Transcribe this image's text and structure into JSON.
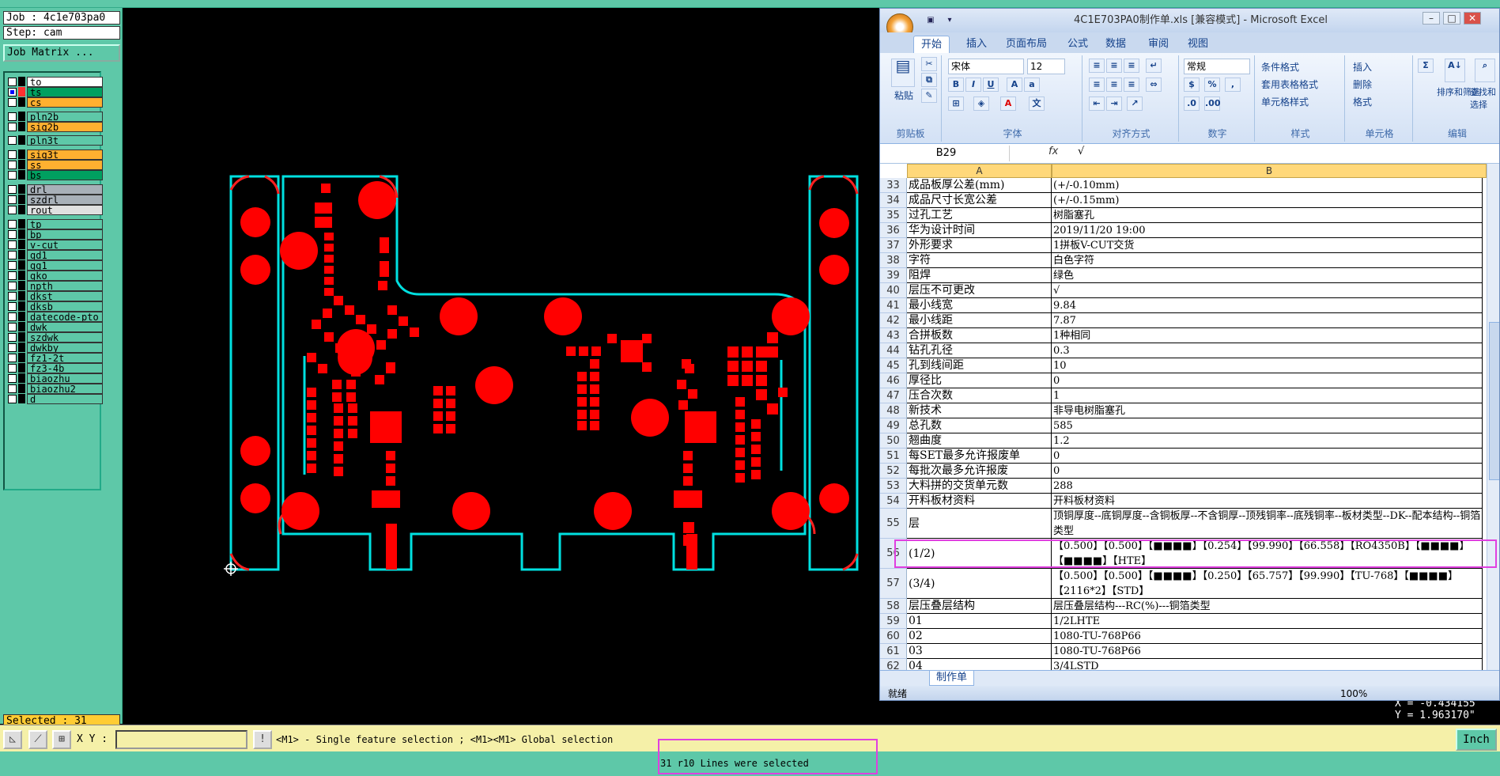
{
  "cam": {
    "job_label": "Job : 4c1e703pa0",
    "step_label": "Step: cam",
    "matrix_button": "Job Matrix ...",
    "selected": "Selected : 31",
    "xy_label": "X Y :",
    "xy_value": "",
    "prompt": "<M1> - Single feature selection ; <M1><M1> Global selection",
    "unit_button": "Inch",
    "status_message": "31 r10 Lines were selected",
    "coord_x": "X = -0.434155",
    "coord_y": "Y = 1.963170\"",
    "layers": [
      {
        "name": "to",
        "bg": "#ffffff",
        "color": "#000000"
      },
      {
        "name": "ts",
        "bg": "#00a060",
        "color": "#ff3030",
        "active": true
      },
      {
        "name": "cs",
        "bg": "#ffb030",
        "color": "#000000"
      },
      {
        "name": "pln2b",
        "bg": "#5ec8a8",
        "color": "#000000"
      },
      {
        "name": "sig2b",
        "bg": "#ffb030",
        "color": "#000000"
      },
      {
        "name": "pln3t",
        "bg": "#5ec8a8",
        "color": "#000000"
      },
      {
        "name": "sig3t",
        "bg": "#ffb030",
        "color": "#000000"
      },
      {
        "name": "ss",
        "bg": "#ffb030",
        "color": "#000000"
      },
      {
        "name": "bs",
        "bg": "#00a060",
        "color": "#000000"
      },
      {
        "name": "drl",
        "bg": "#a8b0b8",
        "color": "#000000"
      },
      {
        "name": "szdrl",
        "bg": "#a8b0b8",
        "color": "#000000"
      },
      {
        "name": "rout",
        "bg": "#e0e0e0",
        "color": "#000000"
      },
      {
        "name": "tp",
        "bg": "#5ec8a8",
        "color": "#000000"
      },
      {
        "name": "bp",
        "bg": "#5ec8a8",
        "color": "#000000"
      },
      {
        "name": "v-cut",
        "bg": "#5ec8a8",
        "color": "#000000"
      },
      {
        "name": "gd1",
        "bg": "#5ec8a8",
        "color": "#000000"
      },
      {
        "name": "gg1",
        "bg": "#5ec8a8",
        "color": "#000000"
      },
      {
        "name": "gko",
        "bg": "#5ec8a8",
        "color": "#000000"
      },
      {
        "name": "npth",
        "bg": "#5ec8a8",
        "color": "#000000"
      },
      {
        "name": "dkst",
        "bg": "#5ec8a8",
        "color": "#000000"
      },
      {
        "name": "dksb",
        "bg": "#5ec8a8",
        "color": "#000000"
      },
      {
        "name": "datecode-pto",
        "bg": "#5ec8a8",
        "color": "#000000"
      },
      {
        "name": "dwk",
        "bg": "#5ec8a8",
        "color": "#000000"
      },
      {
        "name": "szdwk",
        "bg": "#5ec8a8",
        "color": "#000000"
      },
      {
        "name": "dwkby",
        "bg": "#5ec8a8",
        "color": "#000000"
      },
      {
        "name": "fz1-2t",
        "bg": "#5ec8a8",
        "color": "#000000"
      },
      {
        "name": "fz3-4b",
        "bg": "#5ec8a8",
        "color": "#000000"
      },
      {
        "name": "biaozhu",
        "bg": "#5ec8a8",
        "color": "#000000"
      },
      {
        "name": "biaozhu2",
        "bg": "#5ec8a8",
        "color": "#000000"
      },
      {
        "name": "d",
        "bg": "#5ec8a8",
        "color": "#000000"
      }
    ]
  },
  "excel": {
    "title": "4C1E703PA0制作单.xls  [兼容模式] - Microsoft Excel",
    "tabs": [
      "开始",
      "插入",
      "页面布局",
      "公式",
      "数据",
      "审阅",
      "视图"
    ],
    "groups": {
      "clipboard": "剪贴板",
      "font": "字体",
      "align": "对齐方式",
      "number": "数字",
      "style": "样式",
      "cells": "单元格",
      "edit": "编辑"
    },
    "buttons": {
      "paste": "粘贴",
      "cond_format": "条件格式",
      "table_format": "套用表格格式",
      "cell_style": "单元格样式",
      "insert": "插入",
      "delete": "删除",
      "format": "格式",
      "sort": "排序和筛选",
      "find": "查找和选择"
    },
    "font_name": "宋体",
    "font_size": "12",
    "number_format": "常规",
    "name_box": "B29",
    "fx": "fx",
    "formula": "√",
    "col_a": "A",
    "col_b": "B",
    "rows": [
      {
        "num": "33",
        "a": "成品板厚公差(mm)",
        "b": "(+/-0.10mm)"
      },
      {
        "num": "34",
        "a": "成品尺寸长宽公差",
        "b": "(+/-0.15mm)"
      },
      {
        "num": "35",
        "a": "过孔工艺",
        "b": "树脂塞孔"
      },
      {
        "num": "36",
        "a": "华为设计时间",
        "b": "2019/11/20 19:00"
      },
      {
        "num": "37",
        "a": "外形要求",
        "b": "1拼板V-CUT交货"
      },
      {
        "num": "38",
        "a": "字符",
        "b": "白色字符"
      },
      {
        "num": "39",
        "a": "阻焊",
        "b": "绿色"
      },
      {
        "num": "40",
        "a": "层压不可更改",
        "b": "√"
      },
      {
        "num": "41",
        "a": "最小线宽",
        "b": "9.84"
      },
      {
        "num": "42",
        "a": "最小线距",
        "b": "7.87"
      },
      {
        "num": "43",
        "a": "合拼板数",
        "b": "1种相同"
      },
      {
        "num": "44",
        "a": "钻孔孔径",
        "b": "0.3"
      },
      {
        "num": "45",
        "a": "孔到线间距",
        "b": "10"
      },
      {
        "num": "46",
        "a": "厚径比",
        "b": "0"
      },
      {
        "num": "47",
        "a": "压合次数",
        "b": "1"
      },
      {
        "num": "48",
        "a": "新技术",
        "b": "非导电树脂塞孔"
      },
      {
        "num": "49",
        "a": "总孔数",
        "b": "585"
      },
      {
        "num": "50",
        "a": "翘曲度",
        "b": "1.2"
      },
      {
        "num": "51",
        "a": "每SET最多允许报废单",
        "b": "0"
      },
      {
        "num": "52",
        "a": "每批次最多允许报废",
        "b": "0"
      },
      {
        "num": "53",
        "a": "大料拼的交货单元数",
        "b": "288"
      },
      {
        "num": "54",
        "a": "开料板材资料",
        "b": "开料板材资料"
      },
      {
        "num": "55",
        "a": "层",
        "b": "顶铜厚度--底铜厚度--含铜板厚--不含铜厚--顶残铜率--底残铜率--板材类型--DK--配本结构--铜箔类型"
      },
      {
        "num": "56",
        "a": "(1/2)",
        "b": "【0.500】【0.500】【■■■■】【0.254】【99.990】【66.558】【RO4350B】【■■■■】【■■■■】【HTE】"
      },
      {
        "num": "57",
        "a": "(3/4)",
        "b": "【0.500】【0.500】【■■■■】【0.250】【65.757】【99.990】【TU-768】【■■■■】【2116*2】【STD】"
      },
      {
        "num": "58",
        "a": "层压叠层结构",
        "b": "层压叠层结构---RC(%)---铜箔类型"
      },
      {
        "num": "59",
        "a": "01",
        "b": "1/2LHTE"
      },
      {
        "num": "60",
        "a": "02",
        "b": "1080-TU-768P66"
      },
      {
        "num": "61",
        "a": "03",
        "b": "1080-TU-768P66"
      },
      {
        "num": "62",
        "a": "04",
        "b": "3/4LSTD"
      }
    ],
    "sheet_tab": "制作单",
    "status": "就绪",
    "zoom": "100%"
  }
}
